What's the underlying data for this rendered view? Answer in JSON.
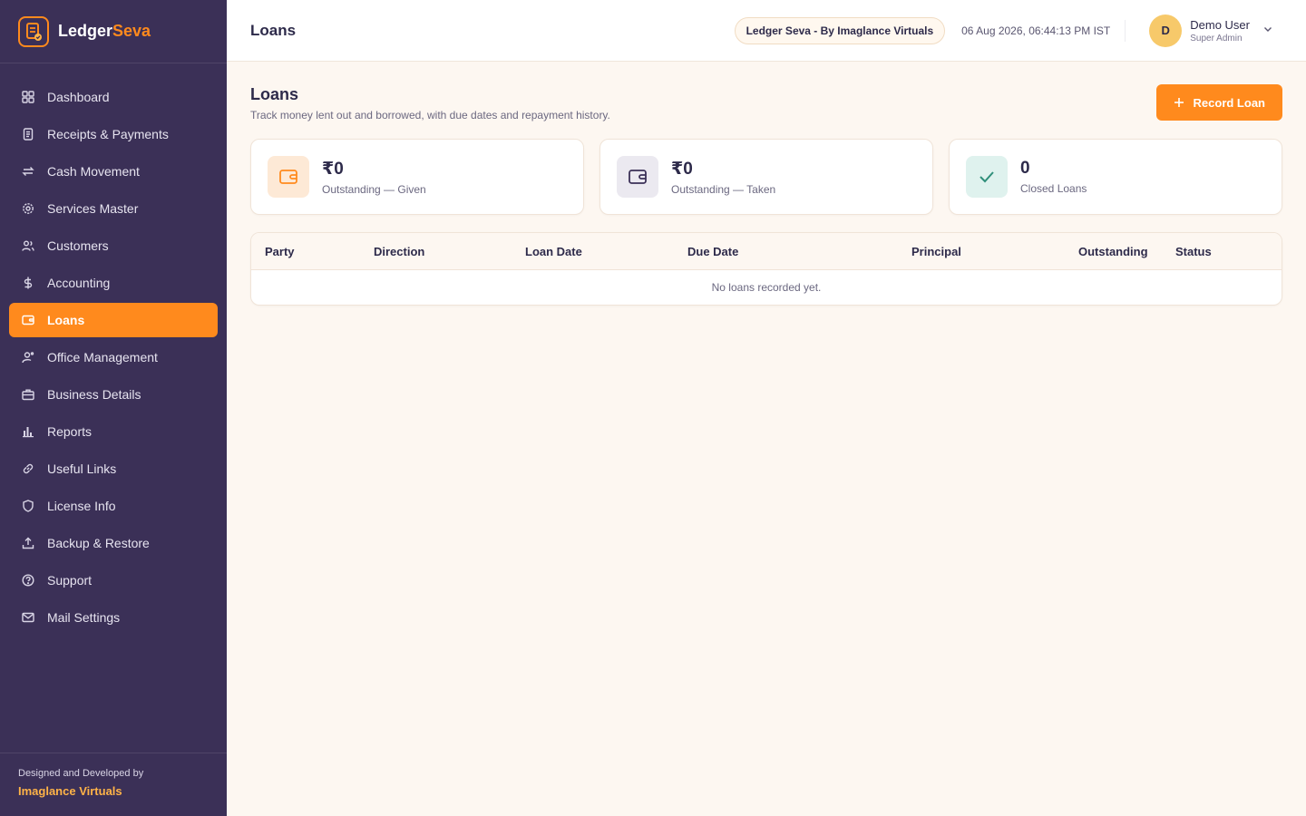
{
  "brand": {
    "name_part1": "Ledger",
    "name_part2": "Seva"
  },
  "sidebar": {
    "items": [
      {
        "label": "Dashboard",
        "icon": "grid-icon"
      },
      {
        "label": "Receipts & Payments",
        "icon": "receipt-icon"
      },
      {
        "label": "Cash Movement",
        "icon": "arrows-swap-icon"
      },
      {
        "label": "Services Master",
        "icon": "gear-icon"
      },
      {
        "label": "Customers",
        "icon": "users-icon"
      },
      {
        "label": "Accounting",
        "icon": "dollar-icon"
      },
      {
        "label": "Loans",
        "icon": "wallet-icon",
        "active": true
      },
      {
        "label": "Office Management",
        "icon": "user-cog-icon"
      },
      {
        "label": "Business Details",
        "icon": "briefcase-icon"
      },
      {
        "label": "Reports",
        "icon": "bar-chart-icon"
      },
      {
        "label": "Useful Links",
        "icon": "link-icon"
      },
      {
        "label": "License Info",
        "icon": "shield-icon"
      },
      {
        "label": "Backup & Restore",
        "icon": "upload-icon"
      },
      {
        "label": "Support",
        "icon": "help-circle-icon"
      },
      {
        "label": "Mail Settings",
        "icon": "mail-icon"
      }
    ],
    "footer": {
      "line1": "Designed and Developed by",
      "line2": "Imaglance Virtuals"
    }
  },
  "header": {
    "title": "Loans",
    "pill": "Ledger Seva - By Imaglance Virtuals",
    "datetime": "06 Aug 2026, 06:44:13 PM IST",
    "user": {
      "initial": "D",
      "name": "Demo User",
      "role": "Super Admin"
    }
  },
  "page": {
    "title": "Loans",
    "subtitle": "Track money lent out and borrowed, with due dates and repayment history.",
    "record_button": "Record Loan"
  },
  "cards": [
    {
      "value": "₹0",
      "label": "Outstanding — Given",
      "icon": "wallet-icon",
      "color": "#ff8a1d",
      "bg": "#fde9d6"
    },
    {
      "value": "₹0",
      "label": "Outstanding — Taken",
      "icon": "wallet-icon",
      "color": "#3b3057",
      "bg": "#ebe9f0"
    },
    {
      "value": "0",
      "label": "Closed Loans",
      "icon": "check-icon",
      "color": "#2f8f7a",
      "bg": "#dff2ee"
    }
  ],
  "table": {
    "columns": [
      "Party",
      "Direction",
      "Loan Date",
      "Due Date",
      "Principal",
      "Outstanding",
      "Status"
    ],
    "empty_text": "No loans recorded yet."
  },
  "colors": {
    "sidebar": "#3b3057",
    "accent": "#ff8a1d",
    "background": "#fdf7f1"
  }
}
